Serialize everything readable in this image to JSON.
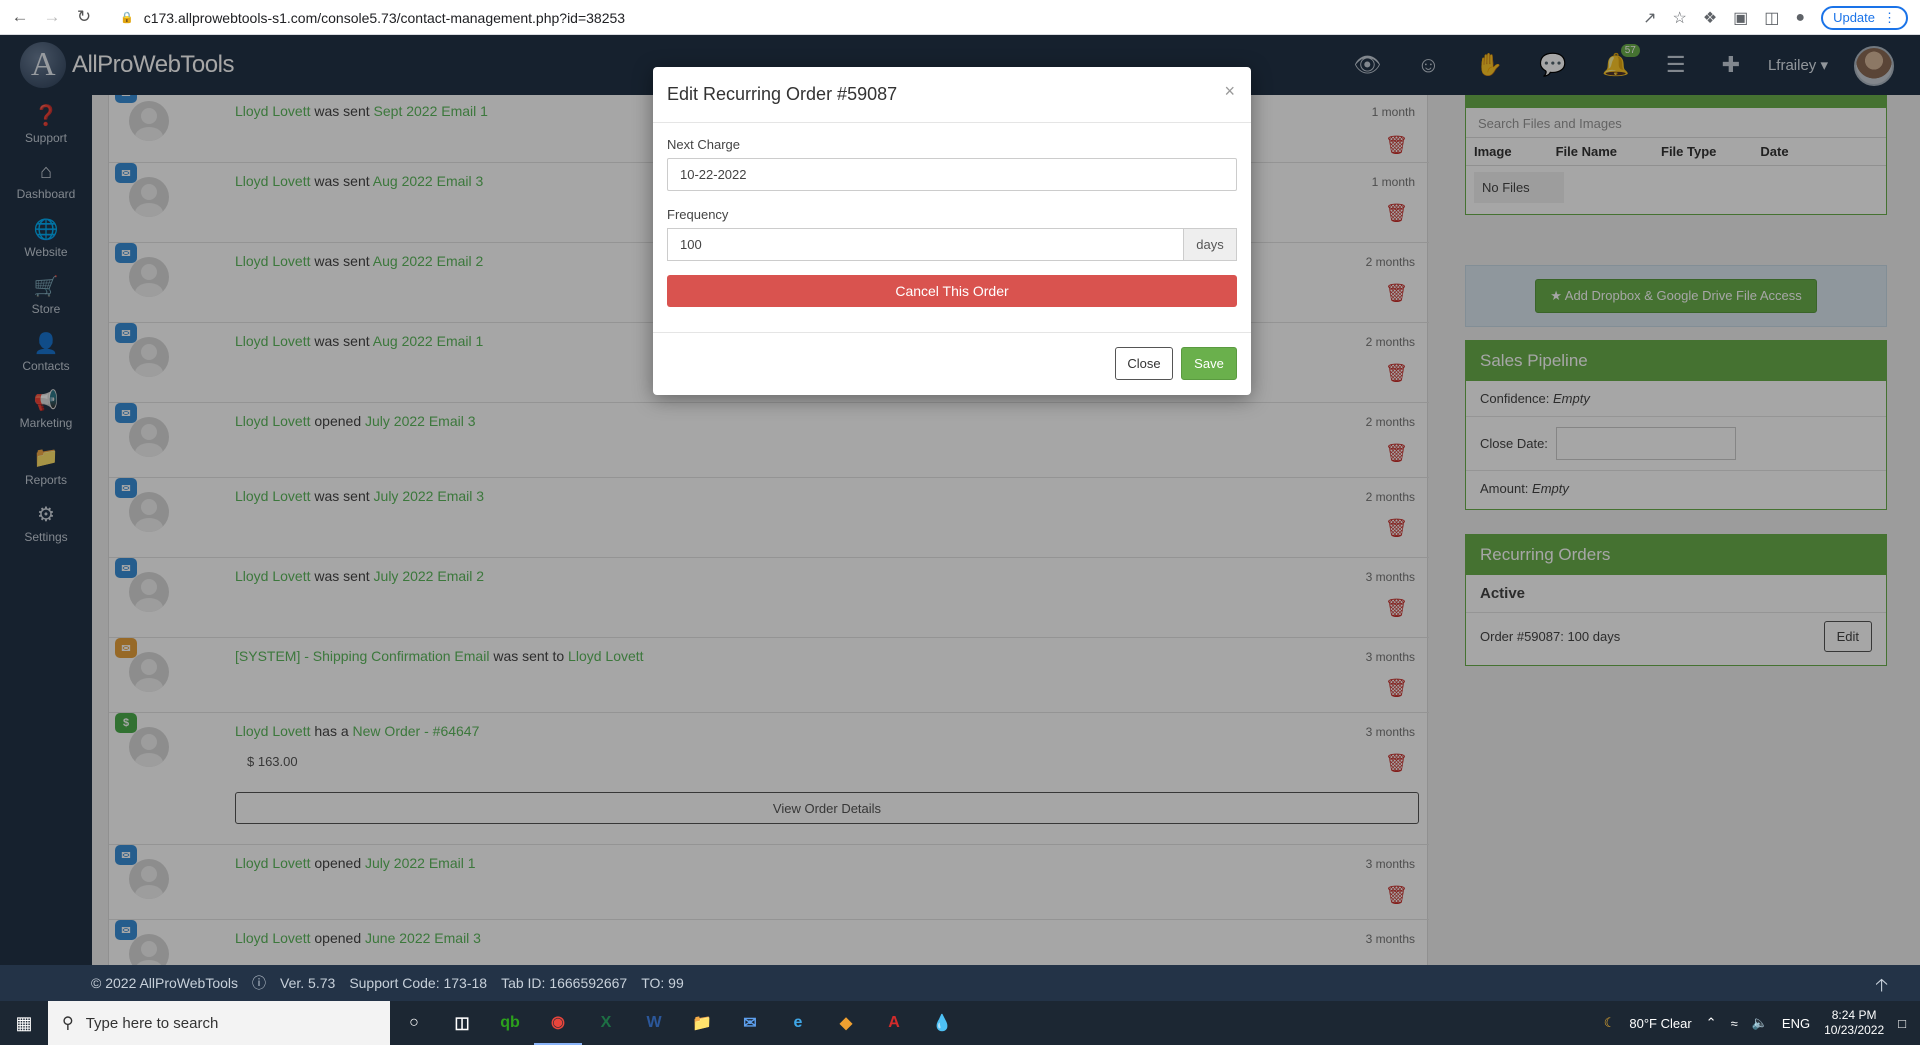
{
  "browser": {
    "url": "c173.allprowebtools-s1.com/console5.73/contact-management.php?id=38253",
    "update_label": "Update"
  },
  "header": {
    "brand": "AllProWebTools",
    "notification_count": "57",
    "user": "Lfrailey"
  },
  "sidebar": {
    "items": [
      {
        "label": "Support",
        "icon": "support-icon"
      },
      {
        "label": "Dashboard",
        "icon": "home-icon"
      },
      {
        "label": "Website",
        "icon": "globe-icon"
      },
      {
        "label": "Store",
        "icon": "cart-icon"
      },
      {
        "label": "Contacts",
        "icon": "user-icon"
      },
      {
        "label": "Marketing",
        "icon": "megaphone-icon"
      },
      {
        "label": "Reports",
        "icon": "folder-icon"
      },
      {
        "label": "Settings",
        "icon": "gear-icon"
      }
    ]
  },
  "feed": [
    {
      "name": "Lloyd Lovett",
      "action": "was sent",
      "item": "Sept 2022 Email 1",
      "time": "1 month"
    },
    {
      "name": "Lloyd Lovett",
      "action": "was sent",
      "item": "Aug 2022 Email 3",
      "time": "1 month"
    },
    {
      "name": "Lloyd Lovett",
      "action": "was sent",
      "item": "Aug 2022 Email 2",
      "time": "2 months"
    },
    {
      "name": "Lloyd Lovett",
      "action": "was sent",
      "item": "Aug 2022 Email 1",
      "time": "2 months"
    },
    {
      "name": "Lloyd Lovett",
      "action": "opened",
      "item": "July 2022 Email 3",
      "time": "2 months"
    },
    {
      "name": "Lloyd Lovett",
      "action": "was sent",
      "item": "July 2022 Email 3",
      "time": "2 months"
    },
    {
      "name": "Lloyd Lovett",
      "action": "was sent",
      "item": "July 2022 Email 2",
      "time": "3 months"
    },
    {
      "system_item": "[SYSTEM] - Shipping Confirmation Email",
      "action": "was sent to",
      "name": "Lloyd Lovett",
      "time": "3 months"
    },
    {
      "name": "Lloyd Lovett",
      "action": "has a",
      "item": "New Order - #64647",
      "time": "3 months",
      "amount": "$ 163.00",
      "button": "View Order Details"
    },
    {
      "name": "Lloyd Lovett",
      "action": "opened",
      "item": "July 2022 Email 1",
      "time": "3 months"
    },
    {
      "name": "Lloyd Lovett",
      "action": "opened",
      "item": "June 2022 Email 3",
      "time": "3 months"
    }
  ],
  "files": {
    "search_placeholder": "Search Files and Images",
    "columns": [
      "Image",
      "File Name",
      "File Type",
      "Date"
    ],
    "empty": "No Files"
  },
  "dropbox_button": "Add Dropbox & Google Drive File Access",
  "sales_pipeline": {
    "title": "Sales Pipeline",
    "confidence_label": "Confidence:",
    "confidence_value": "Empty",
    "close_date_label": "Close Date:",
    "amount_label": "Amount:",
    "amount_value": "Empty"
  },
  "recurring": {
    "title": "Recurring Orders",
    "status": "Active",
    "order_text": "Order #59087: 100 days",
    "edit_label": "Edit"
  },
  "modal": {
    "title": "Edit Recurring Order #59087",
    "next_charge_label": "Next Charge",
    "next_charge_value": "10-22-2022",
    "frequency_label": "Frequency",
    "frequency_value": "100",
    "frequency_unit": "days",
    "cancel_label": "Cancel This Order",
    "close_label": "Close",
    "save_label": "Save"
  },
  "footer": {
    "copyright": "© 2022 AllProWebTools",
    "version": "Ver. 5.73",
    "support_code": "Support Code: 173-18",
    "tab_id": "Tab ID: 1666592667",
    "to": "TO: 99"
  },
  "taskbar": {
    "search_placeholder": "Type here to search",
    "weather": "80°F  Clear",
    "lang": "ENG",
    "time": "8:24 PM",
    "date": "10/23/2022"
  },
  "colors": {
    "accent_green": "#6ab04c",
    "danger": "#d9534f",
    "nav_bg": "#233347"
  }
}
